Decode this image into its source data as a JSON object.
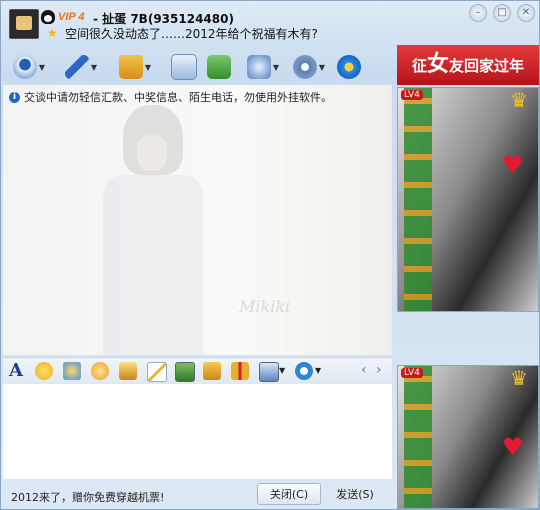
{
  "contact": {
    "vip": "VIP 4",
    "name": "- 扯蛋 7B(935124480)",
    "signature": "空间很久没动态了……2012年给个祝福有木有?"
  },
  "window_controls": [
    "–",
    "□",
    "✕"
  ],
  "toolbar_icons": [
    "video-call-icon",
    "voice-call-icon",
    "send-file-icon",
    "email-icon",
    "add-app-icon",
    "remote-assist-icon",
    "settings-icon",
    "qzone-icon"
  ],
  "notice": "交谈中请勿轻信汇款、中奖信息、陌生电话，勿使用外挂软件。",
  "watermark": "Mikiki",
  "format_icons": [
    "font-icon",
    "emoticon-icon",
    "magic-emoticon-icon",
    "doodle-icon",
    "shake-icon",
    "note-icon",
    "image-icon",
    "music-icon",
    "gift-icon",
    "screenshot-icon",
    "theme-icon"
  ],
  "nav": {
    "prev": "‹",
    "next": "›"
  },
  "bottom": {
    "ad_text": "2012来了，赠你免费穿越机票!",
    "close_label": "关闭(C)",
    "send_label": "发送(S)"
  },
  "ad_banner": {
    "prefix": "征",
    "highlight": "女",
    "suffix": "友回家过年"
  },
  "photo_badge": "LV4"
}
